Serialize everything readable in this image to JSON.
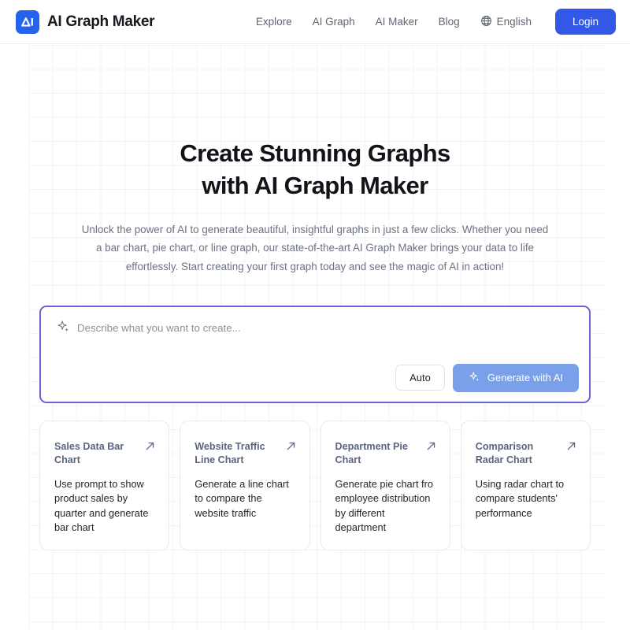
{
  "header": {
    "brand_name": "AI Graph Maker",
    "logo_icon": "ai-logo-mark",
    "nav_items": [
      {
        "label": "Explore",
        "name": "explore"
      },
      {
        "label": "AI Graph",
        "name": "ai-graph"
      },
      {
        "label": "AI Maker",
        "name": "ai-maker"
      },
      {
        "label": "Blog",
        "name": "blog"
      }
    ],
    "language": {
      "label": "English",
      "icon": "globe-icon"
    },
    "login_label": "Login",
    "login_color": "#3358e8"
  },
  "hero": {
    "title_line1": "Create Stunning Graphs",
    "title_line2": "with AI Graph Maker",
    "subtitle": "Unlock the power of AI to generate beautiful, insightful graphs in just a few clicks. Whether you need a bar chart, pie chart, or line graph, our state-of-the-art AI Graph Maker brings your data to life effortlessly. Start creating your first graph today and see the magic of AI in action!"
  },
  "prompt": {
    "placeholder": "Describe what you want to create...",
    "value": "",
    "sparkle_icon": "sparkle-icon",
    "auto_label": "Auto",
    "generate_label": "Generate with AI",
    "border_color": "#6b63d6",
    "generate_color": "#7ba0ea"
  },
  "cards": [
    {
      "title": "Sales Data Bar Chart",
      "description": "Use prompt to show product sales by quarter and generate bar chart",
      "arrow_icon": "arrow-up-right-icon"
    },
    {
      "title": "Website Traffic Line Chart",
      "description": "Generate a line chart to compare the website traffic",
      "arrow_icon": "arrow-up-right-icon"
    },
    {
      "title": "Department Pie Chart",
      "description": "Generate pie chart fro employee distribution by different department",
      "arrow_icon": "arrow-up-right-icon"
    },
    {
      "title": "Comparison Radar Chart",
      "description": "Using radar chart to compare students' performance",
      "arrow_icon": "arrow-up-right-icon"
    }
  ]
}
